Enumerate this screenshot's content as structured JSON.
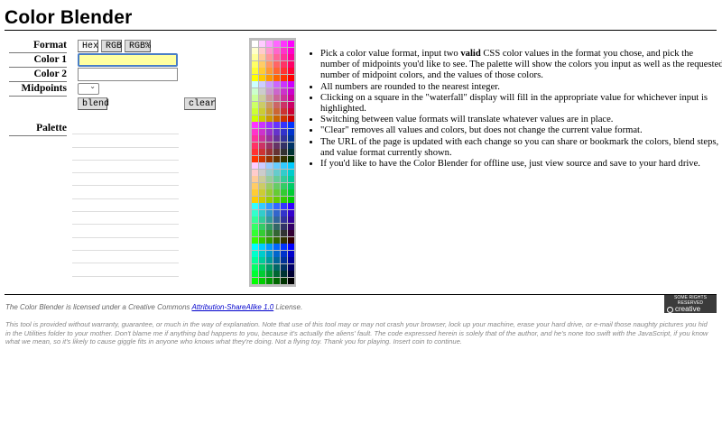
{
  "title": "Color Blender",
  "form": {
    "format_label": "Format",
    "format_options": [
      "Hex",
      "RGB",
      "RGB%"
    ],
    "color1_label": "Color 1",
    "color1_value": "",
    "color2_label": "Color 2",
    "color2_value": "",
    "midpoints_label": "Midpoints",
    "midpoints_value": "",
    "blend_label": "blend",
    "clear_label": "clear",
    "palette_label": "Palette"
  },
  "help_items": [
    {
      "pre": "Pick a color value format, input two ",
      "bold": "valid",
      "post": " CSS color values in the format you chose, and pick the number of midpoints you'd like to see. The palette will show the colors you input as well as the requested number of midpoint colors, and the values of those colors."
    },
    {
      "pre": "All numbers are rounded to the nearest integer.",
      "bold": "",
      "post": ""
    },
    {
      "pre": "Clicking on a square in the \"waterfall\" display will fill in the appropriate value for whichever input is highlighted.",
      "bold": "",
      "post": ""
    },
    {
      "pre": "Switching between value formats will translate whatever values are in place.",
      "bold": "",
      "post": ""
    },
    {
      "pre": "\"Clear\" removes all values and colors, but does not change the current value format.",
      "bold": "",
      "post": ""
    },
    {
      "pre": "The URL of the page is updated with each change so you can share or bookmark the colors, blend steps, and value format currently shown.",
      "bold": "",
      "post": ""
    },
    {
      "pre": "If you'd like to have the Color Blender for offline use, just view source and save to your hard drive.",
      "bold": "",
      "post": ""
    }
  ],
  "footer": {
    "license_pre": "The Color Blender is licensed under a Creative Commons ",
    "license_link": "Attribution-ShareAlike 1.0",
    "license_post": " License.",
    "cc_badge_top": "SOME RIGHTS RESERVED",
    "cc_badge_bottom": "creative commons",
    "disclaimer": "This tool is provided without warranty, guarantee, or much in the way of explanation. Note that use of this tool may or may not crash your browser, lock up your machine, erase your hard drive, or e-mail those naughty pictures you hid in the Utilities folder to your mother. Don't blame me if anything bad happens to you, because it's actually the aliens' fault. The code expressed herein is solely that of the author, and he's none too swift with the JavaScript, if you know what we mean, so it's likely to cause giggle fits in anyone who knows what they're doing. Not a flying toy. Thank you for playing. Insert coin to continue."
  },
  "colors": {
    "color1_bg": "#ffffa0",
    "focus_border": "#4a7ec6",
    "link": "#0000cc"
  }
}
